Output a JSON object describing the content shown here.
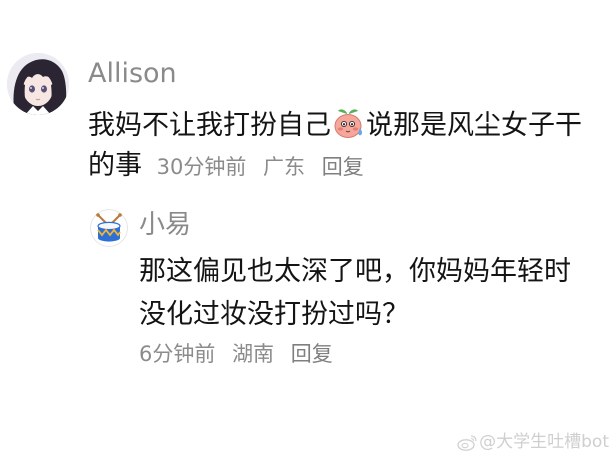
{
  "comment": {
    "author": "Allison",
    "text_part1": "我妈不让我打扮自己",
    "emoji": "blushing-peach-emoji",
    "text_part2": "说那是风尘女子干的事",
    "time": "30分钟前",
    "location": "广东",
    "reply_label": "回复"
  },
  "reply": {
    "author": "小易",
    "text": "那这偏见也太深了吧，你妈妈年轻时没化过妆没打扮过吗？",
    "time": "6分钟前",
    "location": "湖南",
    "reply_label": "回复"
  },
  "watermark": {
    "text": "@大学生吐槽bot"
  },
  "colors": {
    "text_primary": "#141414",
    "text_secondary": "#8a8a8a",
    "background": "#ffffff",
    "drum_blue": "#2e6fd6",
    "drum_yellow": "#f2b531"
  }
}
